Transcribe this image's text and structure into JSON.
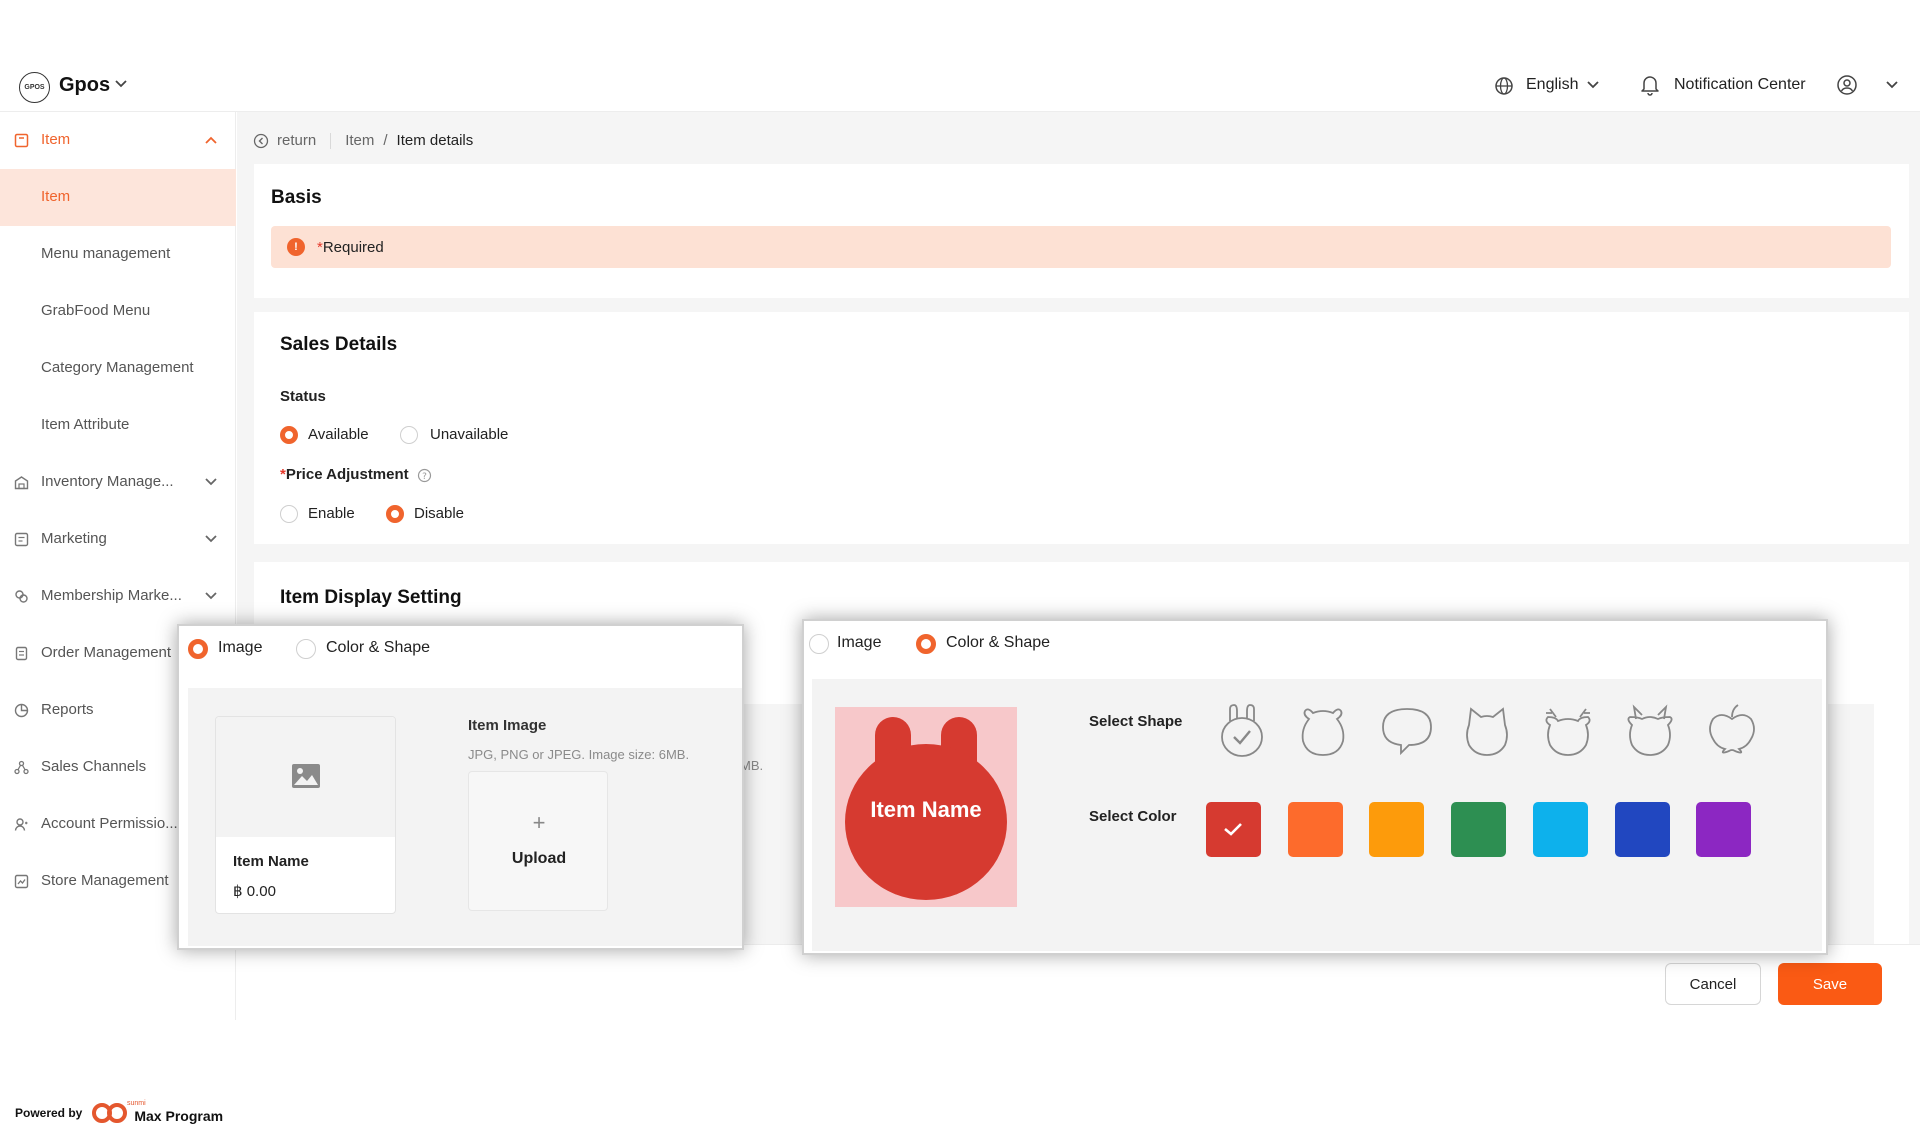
{
  "header": {
    "logo_text": "GPOS",
    "app_name": "Gpos",
    "language": "English",
    "notification": "Notification Center"
  },
  "sidebar": {
    "items": [
      {
        "label": "Item",
        "icon": "item-box-icon",
        "expanded": true
      },
      {
        "label": "Item",
        "active": true
      },
      {
        "label": "Menu management"
      },
      {
        "label": "GrabFood Menu"
      },
      {
        "label": "Category Management"
      },
      {
        "label": "Item Attribute"
      },
      {
        "label": "Inventory Manage...",
        "icon": "warehouse-icon"
      },
      {
        "label": "Marketing",
        "icon": "marketing-icon"
      },
      {
        "label": "Membership Marke...",
        "icon": "membership-icon"
      },
      {
        "label": "Order Management",
        "icon": "order-icon"
      },
      {
        "label": "Reports",
        "icon": "reports-icon"
      },
      {
        "label": "Sales Channels",
        "icon": "channels-icon"
      },
      {
        "label": "Account Permissio...",
        "icon": "account-icon"
      },
      {
        "label": "Store Management",
        "icon": "store-icon"
      }
    ],
    "powered_by": "Powered by",
    "brand_small": "sunmi",
    "brand": "Max Program"
  },
  "breadcrumb": {
    "return": "return",
    "parent": "Item",
    "separator": "/",
    "current": "Item details"
  },
  "basis": {
    "title": "Basis",
    "required_star": "*",
    "required_text": "Required"
  },
  "sales": {
    "title": "Sales Details",
    "status_label": "Status",
    "status_options": [
      "Available",
      "Unavailable"
    ],
    "status_selected": "Available",
    "price_star": "*",
    "price_label": "Price Adjustment",
    "price_options": [
      "Enable",
      "Disable"
    ],
    "price_selected": "Disable"
  },
  "display": {
    "title": "Item Display Setting",
    "hidden_hint_tail": "MB."
  },
  "footer": {
    "cancel": "Cancel",
    "save": "Save"
  },
  "panel_image": {
    "options": [
      "Image",
      "Color & Shape"
    ],
    "selected": "Image",
    "item_name": "Item Name",
    "item_price": "฿ 0.00",
    "image_title": "Item Image",
    "image_hint": "JPG, PNG or JPEG. Image size: 6MB.",
    "upload_plus": "+",
    "upload": "Upload"
  },
  "panel_shape": {
    "options": [
      "Image",
      "Color & Shape"
    ],
    "selected": "Color & Shape",
    "preview_name": "Item Name",
    "select_shape": "Select Shape",
    "select_color": "Select Color",
    "shapes": [
      "rabbit-shape-icon",
      "bear-shape-icon",
      "speech-shape-icon",
      "cat-shape-icon",
      "deer-shape-icon",
      "cow-shape-icon",
      "apple-shape-icon"
    ],
    "selected_shape": "rabbit-shape-icon",
    "colors": [
      "#d63a30",
      "#fd6b2c",
      "#fd9b0b",
      "#2d8f52",
      "#0db1ec",
      "#2147c0",
      "#8c27c2"
    ],
    "selected_color": "#d63a30"
  },
  "theme": {
    "accent": "#f0642d",
    "active_bg": "#fde5db",
    "banner_bg": "#fde1d4",
    "save_bg": "#fa5a14"
  }
}
